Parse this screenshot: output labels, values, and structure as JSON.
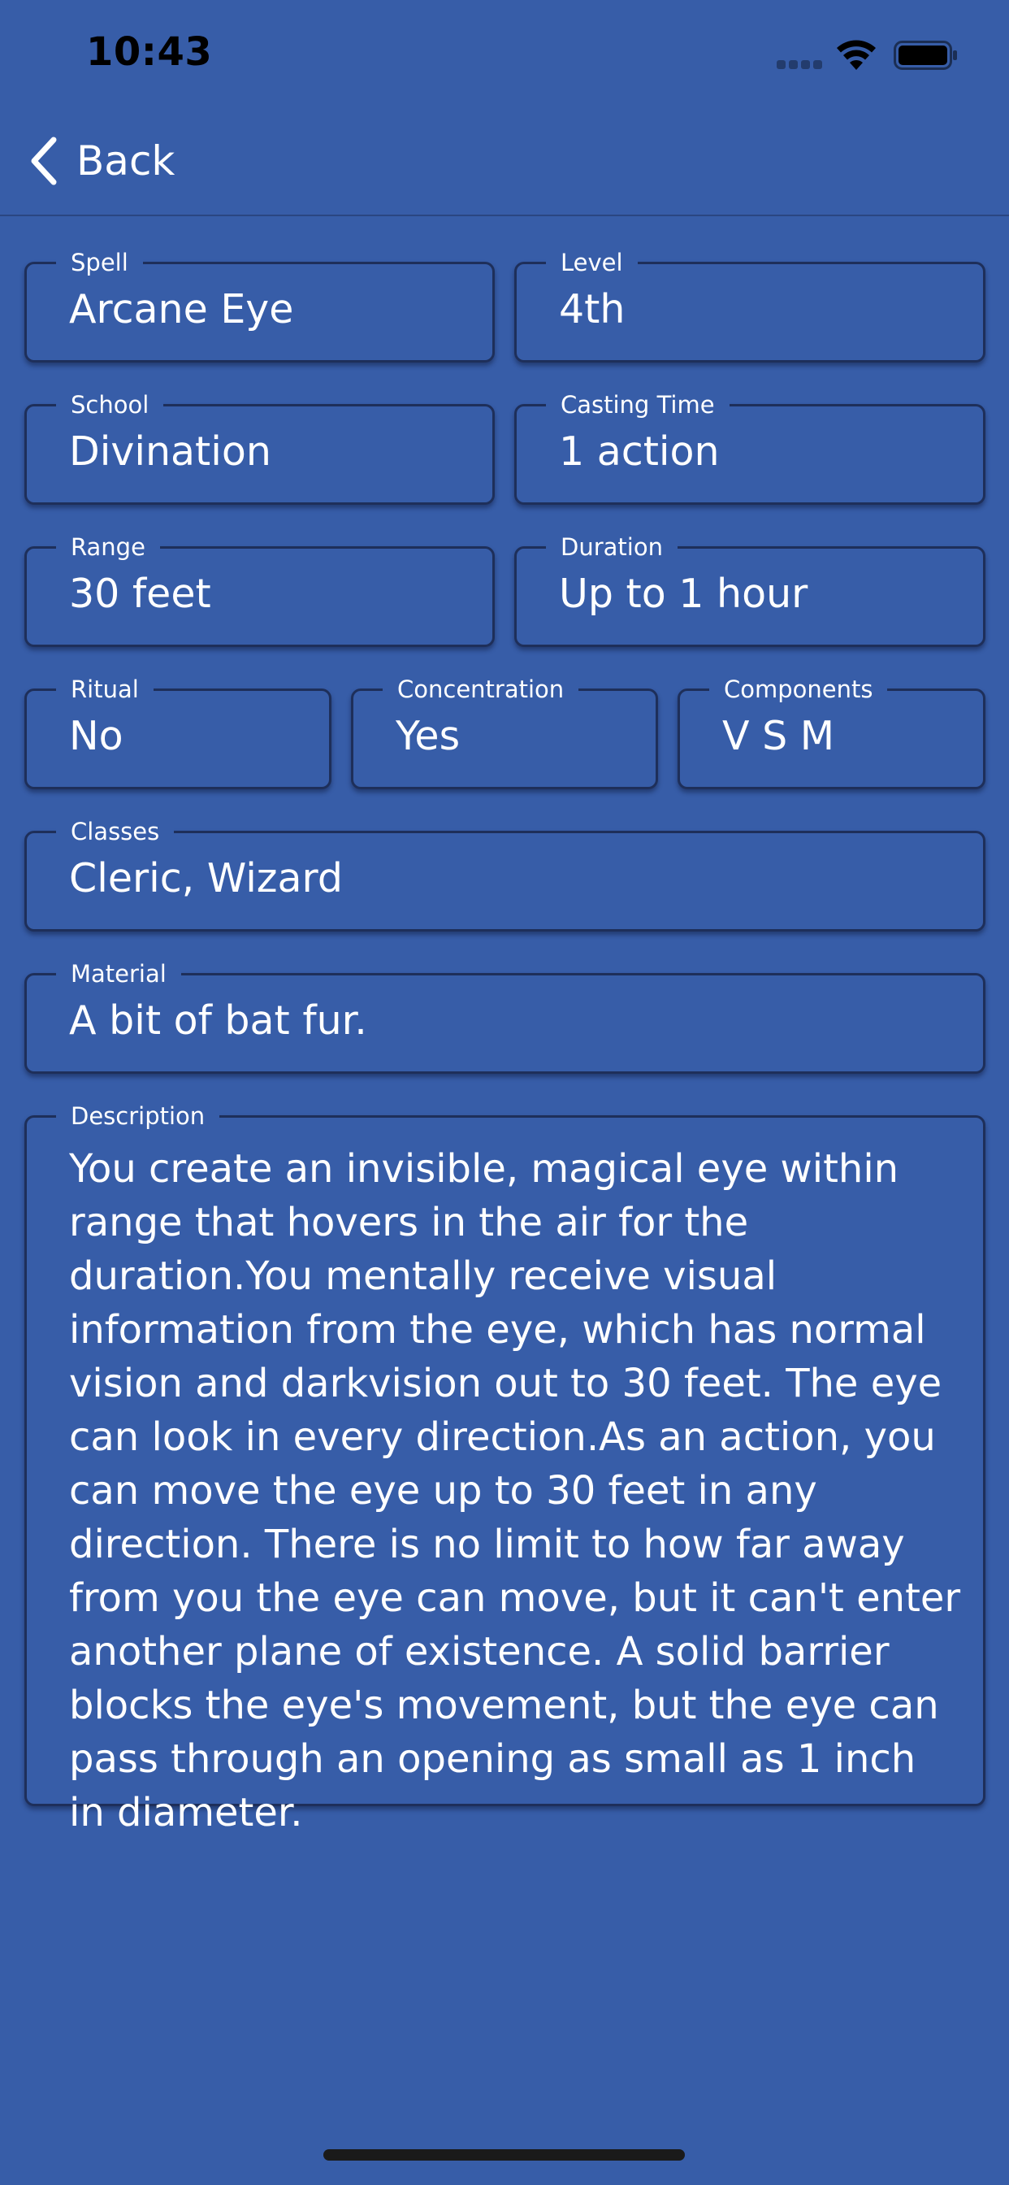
{
  "status_bar": {
    "time": "10:43"
  },
  "nav": {
    "back_label": "Back"
  },
  "fields": {
    "spell": {
      "label": "Spell",
      "value": "Arcane Eye"
    },
    "level": {
      "label": "Level",
      "value": "4th"
    },
    "school": {
      "label": "School",
      "value": "Divination"
    },
    "casting_time": {
      "label": "Casting Time",
      "value": "1 action"
    },
    "range": {
      "label": "Range",
      "value": "30 feet"
    },
    "duration": {
      "label": "Duration",
      "value": "Up to 1 hour"
    },
    "ritual": {
      "label": "Ritual",
      "value": "No"
    },
    "concentration": {
      "label": "Concentration",
      "value": "Yes"
    },
    "components": {
      "label": "Components",
      "value": "V S M"
    },
    "classes": {
      "label": "Classes",
      "value": "Cleric, Wizard"
    },
    "material": {
      "label": "Material",
      "value": "A bit of bat fur."
    },
    "description": {
      "label": "Description",
      "value": "You create an invisible, magical eye within range that hovers in the air for the duration.You mentally receive visual information from the eye, which has normal vision and darkvision out to 30 feet. The eye can look in every direction.As an action, you can move the eye up to 30 feet in any direction. There is no limit to how far away from you the eye can move, but it can't enter another plane of existence. A solid barrier blocks the eye's movement, but the eye can pass through an opening as small as 1 inch in diameter."
    }
  },
  "colors": {
    "background": "#375da8",
    "field_border": "#1e2f5a",
    "text": "#ffffff"
  }
}
